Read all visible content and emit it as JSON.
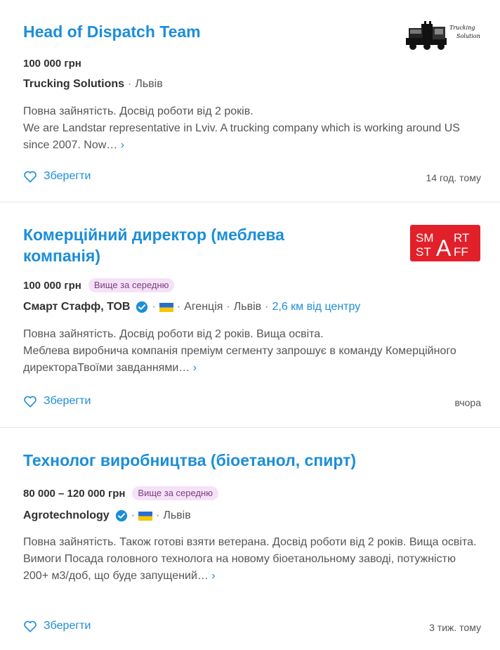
{
  "jobs": [
    {
      "title": "Head of Dispatch Team",
      "salary": "100 000 грн",
      "badge": "",
      "company": "Trucking Solutions",
      "location": "Львів",
      "summary": "Повна зайнятість. Досвід роботи від 2 років.",
      "description": "We are Landstar representative in Lviv. A trucking company which is working around US since 2007. Now…",
      "more": "›",
      "save_label": "Зберегти",
      "posted": "14 год. тому",
      "logo_text": [
        "Trucking",
        "Solutions"
      ]
    },
    {
      "title": "Комерційний директор (меблева компанія)",
      "salary": "100 000 грн",
      "badge": "Вище за середню",
      "company": "Смарт Стафф, ТОВ",
      "agency": "Агенція",
      "location": "Львів",
      "distance": "2,6 км від центру",
      "summary": "Повна зайнятість. Досвід роботи від 2 років. Вища освіта.",
      "description": "Меблева виробнича компанія преміум сегменту запрошує в команду Комерційного директораТвоїми завданнями…",
      "more": "›",
      "save_label": "Зберегти",
      "posted": "вчора",
      "logo_text": [
        "SM",
        "RT",
        "ST",
        "FF",
        "A"
      ]
    },
    {
      "title": "Технолог виробництва (біоетанол, спирт)",
      "salary": "80 000 – 120 000 грн",
      "badge": "Вище за середню",
      "company": "Agrotechnology",
      "location": "Львів",
      "summary": "Повна зайнятість. Також готові взяти ветерана. Досвід роботи від 2 років. Вища освіта.",
      "description": "Вимоги Посада головного технолога на новому біоетанольному заводі, потужністю 200+ м3/доб, що буде запущений…",
      "more": "›",
      "save_label": "Зберегти",
      "posted": "3 тиж. тому"
    }
  ],
  "separator": "·",
  "colors": {
    "link": "#1c8ed8",
    "badge_bg": "#f5e2f7",
    "logo_red": "#e2202a",
    "verified": "#1c8ed8"
  },
  "icons": {
    "save": "heart-outline-icon",
    "verified": "verified-check-icon",
    "flag": "ukraine-flag-icon"
  }
}
